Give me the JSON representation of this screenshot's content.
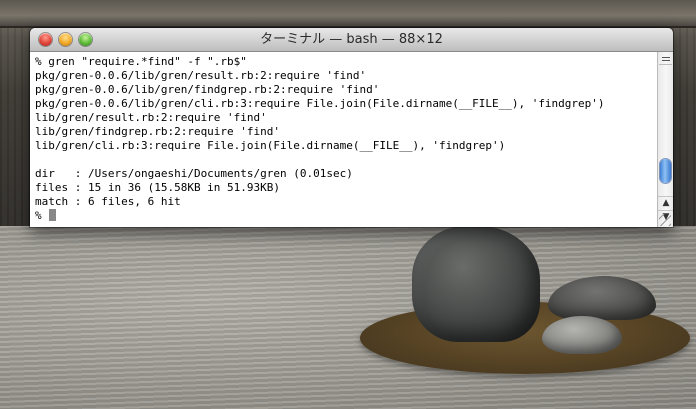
{
  "window": {
    "title": "ターミナル — bash — 88×12"
  },
  "terminal": {
    "lines": [
      "% gren \"require.*find\" -f \".rb$\"",
      "pkg/gren-0.0.6/lib/gren/result.rb:2:require 'find'",
      "pkg/gren-0.0.6/lib/gren/findgrep.rb:2:require 'find'",
      "pkg/gren-0.0.6/lib/gren/cli.rb:3:require File.join(File.dirname(__FILE__), 'findgrep')",
      "lib/gren/result.rb:2:require 'find'",
      "lib/gren/findgrep.rb:2:require 'find'",
      "lib/gren/cli.rb:3:require File.join(File.dirname(__FILE__), 'findgrep')",
      "",
      "dir   : /Users/ongaeshi/Documents/gren (0.01sec)",
      "files : 15 in 36 (15.58KB in 51.93KB)",
      "match : 6 files, 6 hit"
    ],
    "prompt": "%"
  },
  "scrollbar": {
    "up_arrow": "▲",
    "down_arrow": "▼"
  },
  "icons": {
    "close": "close-icon",
    "minimize": "minimize-icon",
    "zoom": "zoom-icon"
  },
  "colors": {
    "close": "#e0443a",
    "minimize": "#f0a928",
    "zoom": "#5dbb3a",
    "scroll_thumb": "#3d7fd6"
  }
}
